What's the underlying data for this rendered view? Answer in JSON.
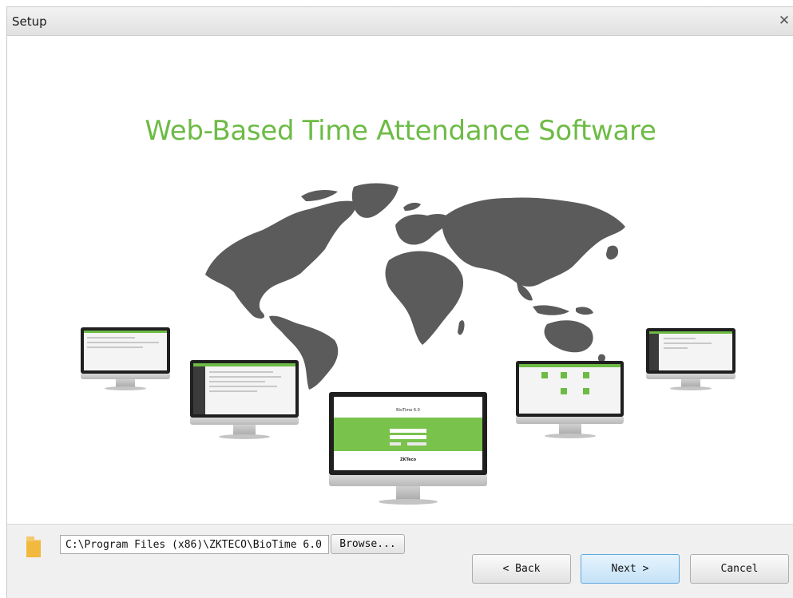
{
  "window": {
    "title": "Setup",
    "close_glyph": "✕"
  },
  "hero": {
    "headline": "Web-Based Time Attendance Software",
    "illustration": "world-map-with-monitors",
    "accent_color": "#6dbb45",
    "center_screen": {
      "brand": "BioTime 6.0",
      "logo": "ZKTeco"
    }
  },
  "install": {
    "path_value": "C:\\Program Files (x86)\\ZKTECO\\BioTime 6.0",
    "browse_label": "Browse..."
  },
  "footer": {
    "back_label": "< Back",
    "next_label": "Next >",
    "cancel_label": "Cancel"
  },
  "icons": {
    "folder": "folder-icon",
    "close": "close-icon"
  }
}
